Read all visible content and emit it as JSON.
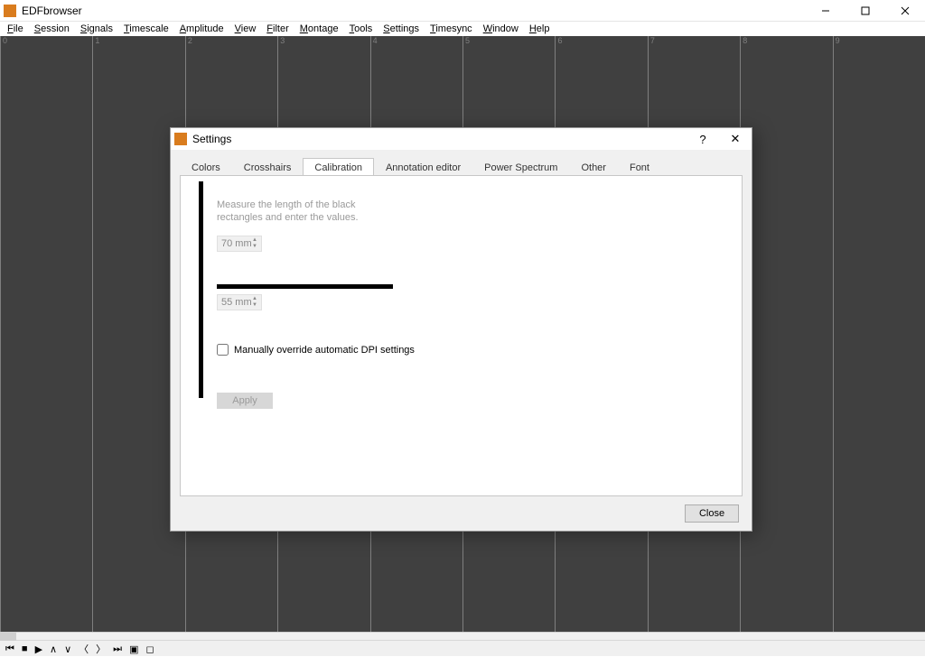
{
  "app": {
    "title": "EDFbrowser",
    "icon_color": "#d97c1e"
  },
  "menu": [
    "File",
    "Session",
    "Signals",
    "Timescale",
    "Amplitude",
    "View",
    "Filter",
    "Montage",
    "Tools",
    "Settings",
    "Timesync",
    "Window",
    "Help"
  ],
  "ruler_ticks": [
    "0",
    "1",
    "2",
    "3",
    "4",
    "5",
    "6",
    "7",
    "8",
    "9"
  ],
  "transport_icons": [
    "skip-start",
    "stop",
    "play",
    "up",
    "down",
    "prev",
    "next",
    "skip-end",
    "rec-stop-square",
    "rec-square"
  ],
  "dialog": {
    "title": "Settings",
    "help_glyph": "?",
    "close_glyph": "✕",
    "tabs": [
      "Colors",
      "Crosshairs",
      "Calibration",
      "Annotation editor",
      "Power Spectrum",
      "Other",
      "Font"
    ],
    "active_tab_index": 2,
    "calibration": {
      "instruction": "Measure the length of the black rectangles and enter the values.",
      "vertical_value": "70 mm",
      "horizontal_value": "55 mm",
      "override_label": "Manually override automatic DPI settings",
      "override_checked": false,
      "apply_label": "Apply",
      "apply_enabled": false
    },
    "close_label": "Close"
  }
}
